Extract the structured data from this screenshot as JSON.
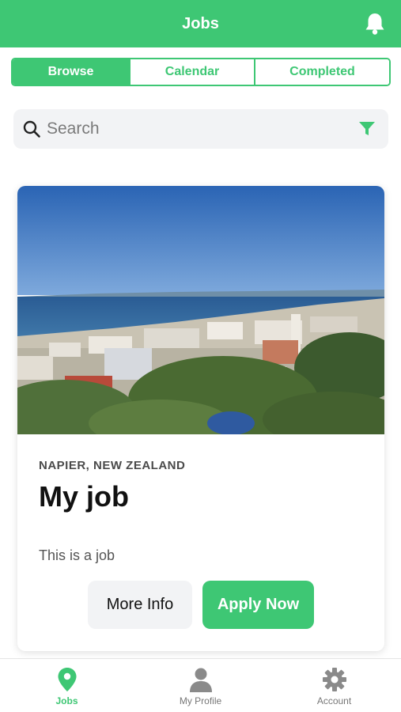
{
  "header": {
    "title": "Jobs",
    "notification_icon": "bell-icon"
  },
  "tabs": [
    {
      "label": "Browse",
      "active": true
    },
    {
      "label": "Calendar",
      "active": false
    },
    {
      "label": "Completed",
      "active": false
    }
  ],
  "search": {
    "placeholder": "Search",
    "value": "",
    "search_icon": "search-icon",
    "filter_icon": "filter-icon"
  },
  "job_card": {
    "image": "coastal-city-photo",
    "location": "NAPIER, NEW ZEALAND",
    "title": "My job",
    "description": "This is a job",
    "more_info_label": "More Info",
    "apply_label": "Apply Now"
  },
  "bottom_nav": [
    {
      "label": "Jobs",
      "icon": "map-pin-icon",
      "active": true
    },
    {
      "label": "My Profile",
      "icon": "person-icon",
      "active": false
    },
    {
      "label": "Account",
      "icon": "gear-icon",
      "active": false
    }
  ],
  "colors": {
    "accent": "#3ec774",
    "inactive_icon": "#8a8a8a",
    "surface": "#f2f3f5"
  }
}
